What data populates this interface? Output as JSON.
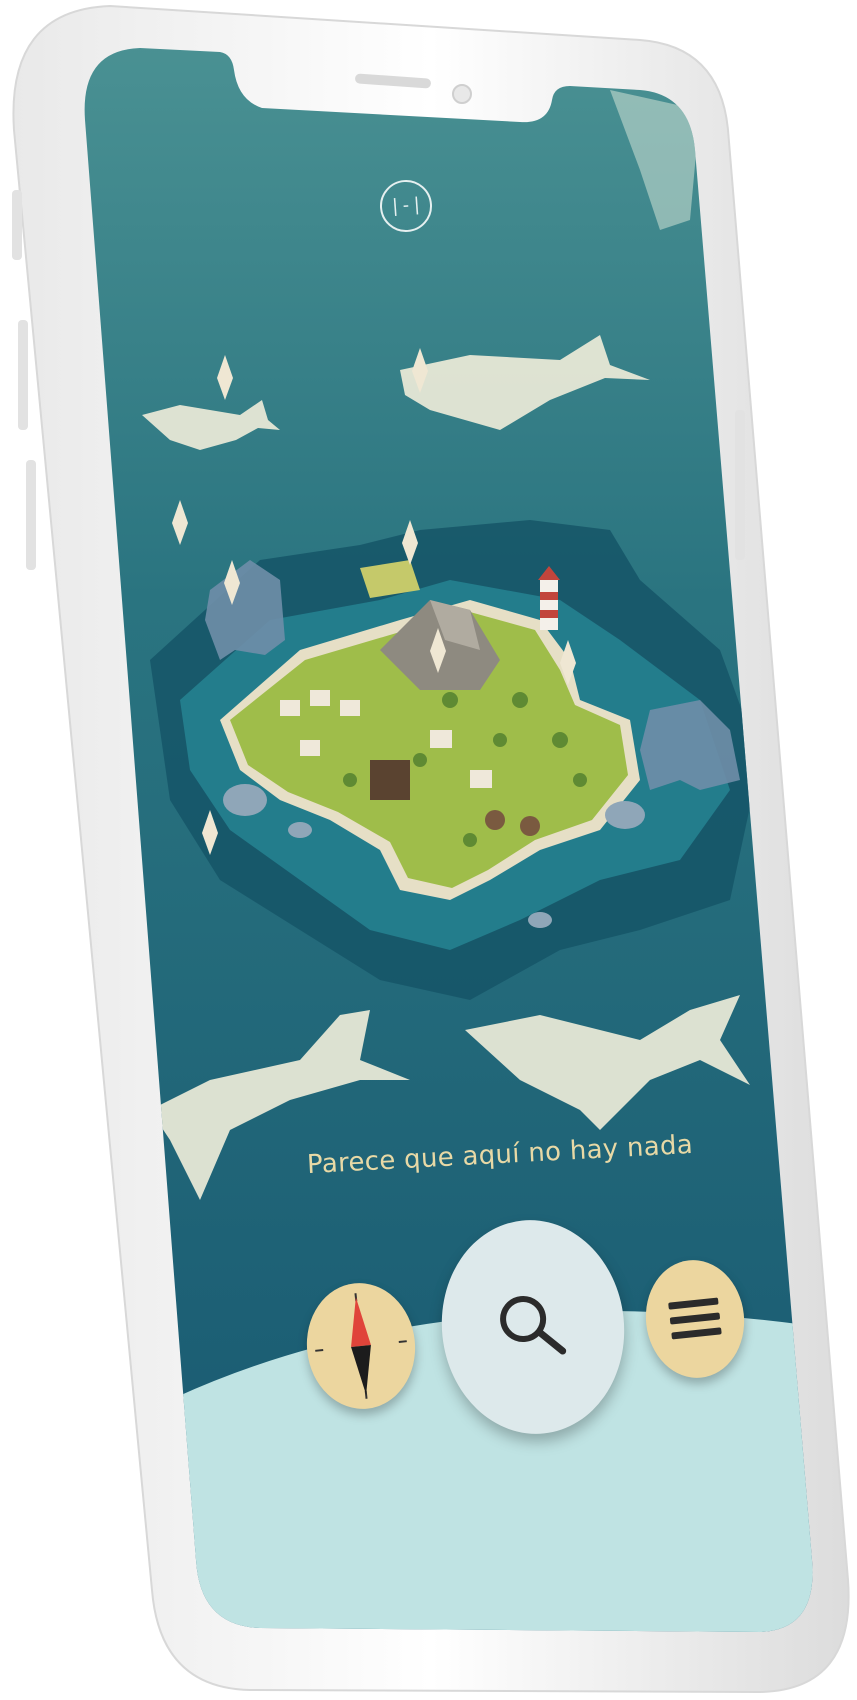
{
  "app": {
    "logo_label": "|-|"
  },
  "map": {
    "status_message": "Parece que aquí no hay nada"
  },
  "controls": {
    "compass": "compass-icon",
    "search": "search-icon",
    "menu": "menu-icon"
  },
  "colors": {
    "ocean_top": "#3f8a8c",
    "ocean_bottom": "#1a5a70",
    "island_grass": "#9fbd4a",
    "button_cream": "#ecd69f",
    "button_light": "#dde9eb",
    "bottom_panel": "#bfe3e3",
    "text_accent": "#e8d9a6"
  }
}
